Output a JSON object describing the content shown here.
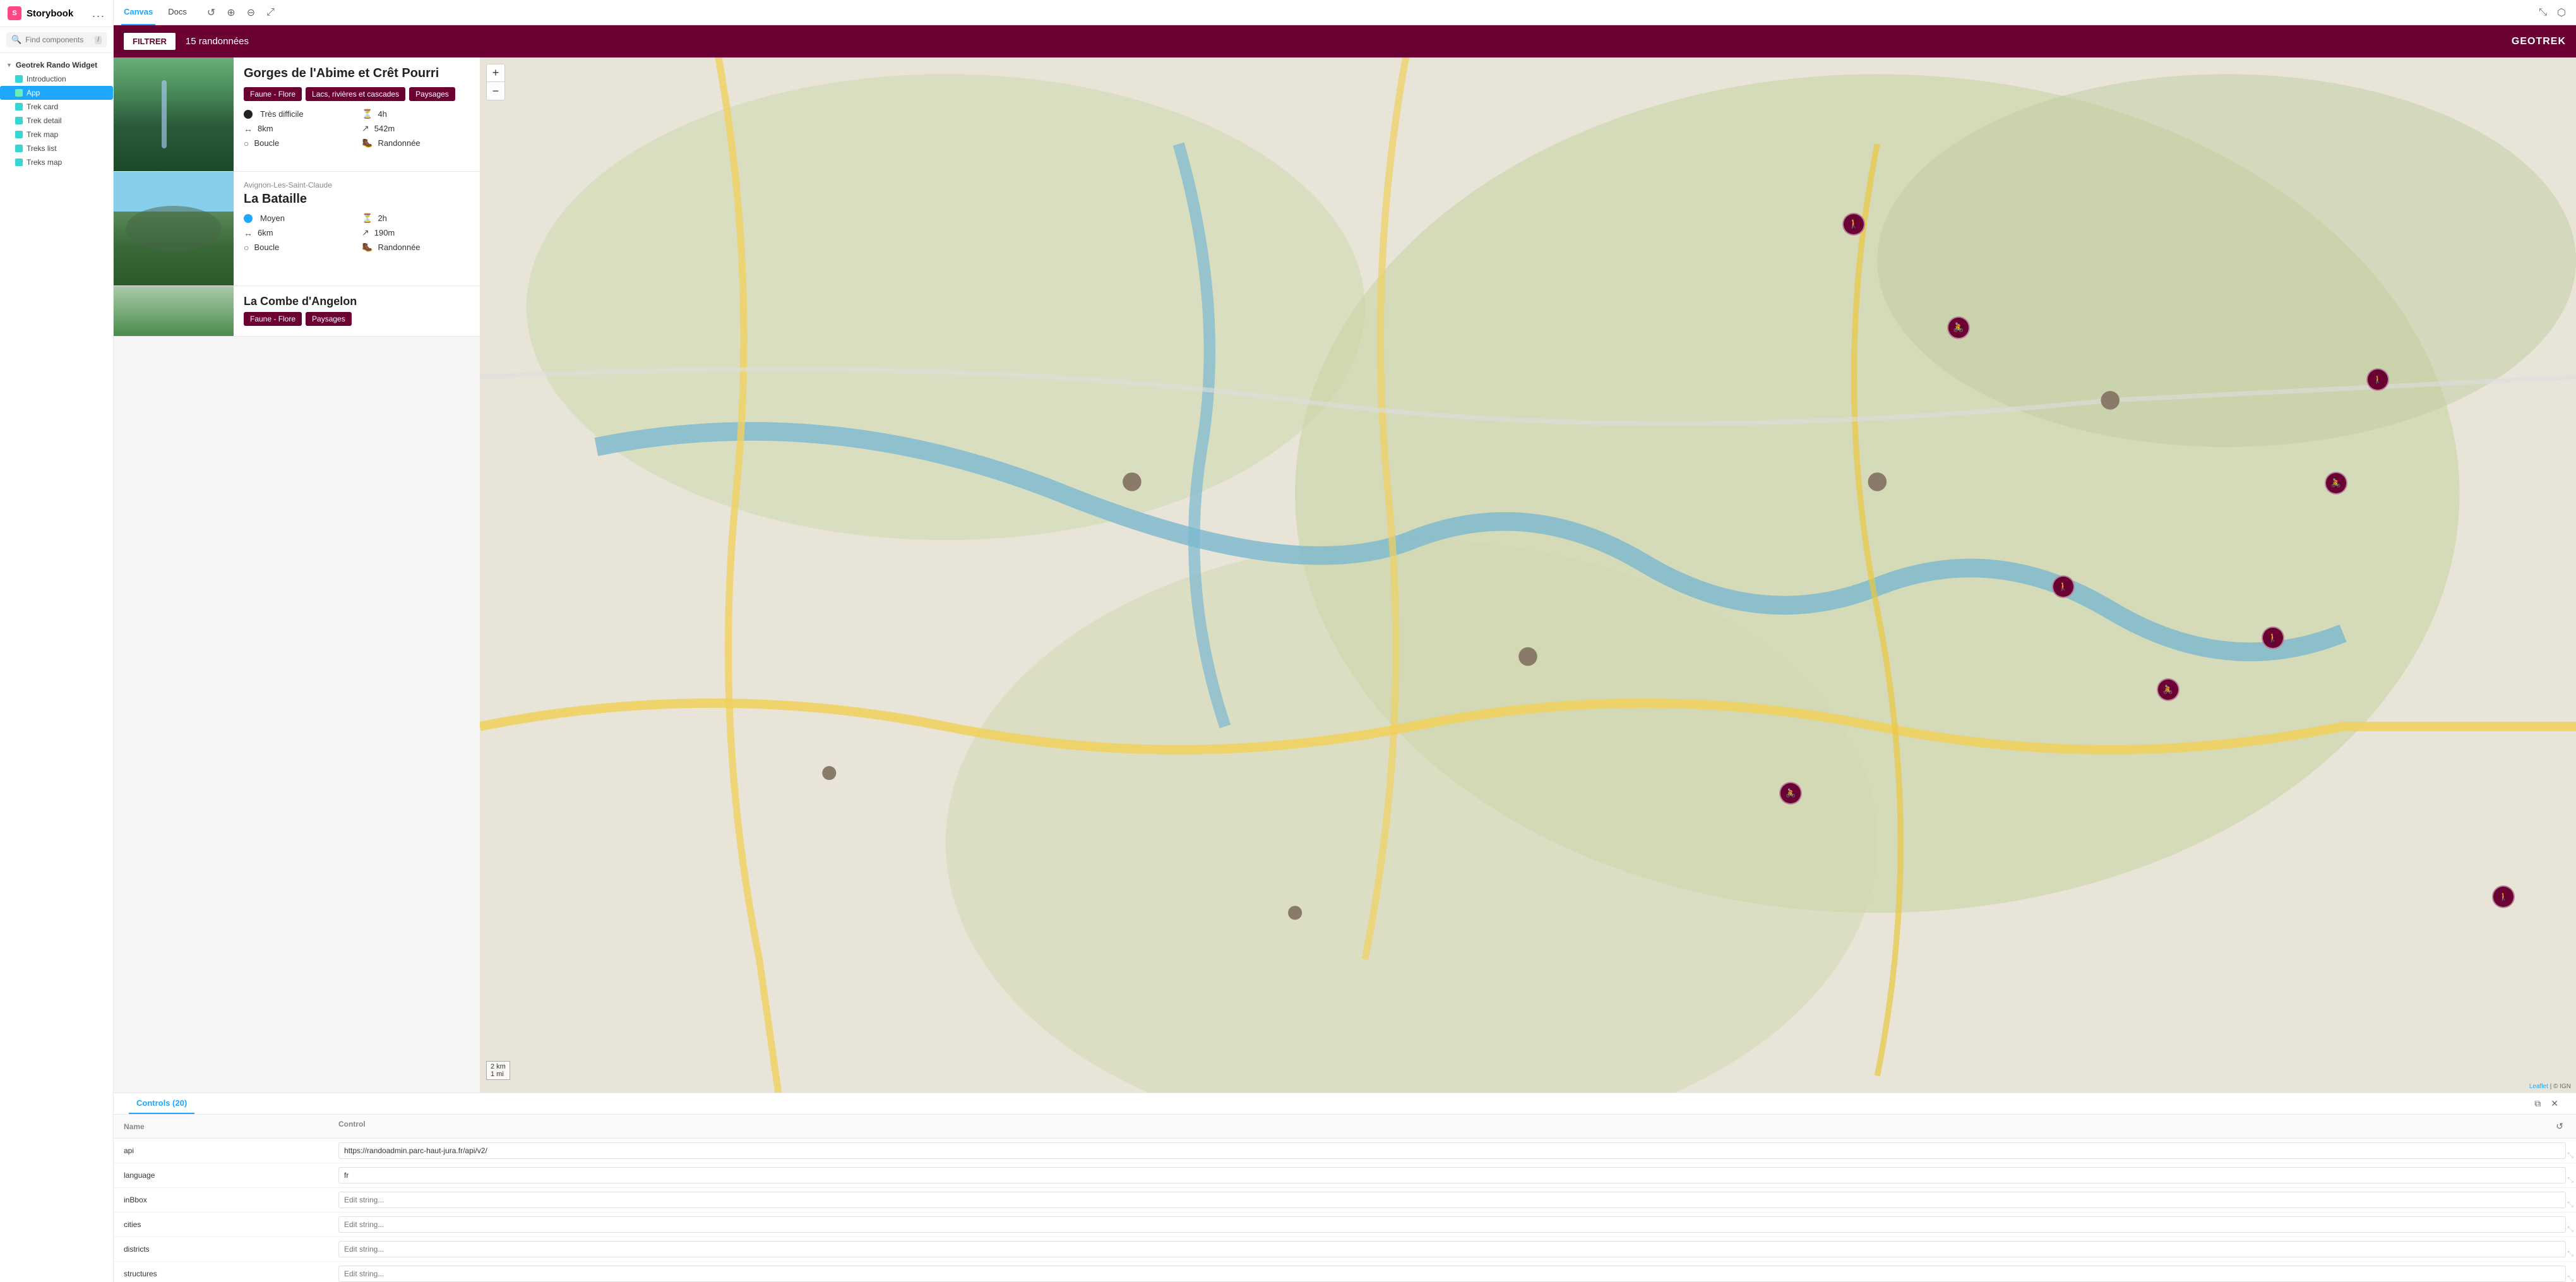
{
  "sidebar": {
    "logo": "Storybook",
    "menu_dots": "...",
    "search_placeholder": "Find components",
    "slash_key": "/",
    "tree": {
      "group_label": "Geotrek Rando Widget",
      "items": [
        {
          "label": "Introduction",
          "icon": "story",
          "active": false
        },
        {
          "label": "App",
          "icon": "component",
          "active": true
        },
        {
          "label": "Trek card",
          "icon": "story",
          "active": false
        },
        {
          "label": "Trek detail",
          "icon": "story",
          "active": false
        },
        {
          "label": "Trek map",
          "icon": "story",
          "active": false
        },
        {
          "label": "Treks list",
          "icon": "story",
          "active": false
        },
        {
          "label": "Treks map",
          "icon": "story",
          "active": false
        }
      ]
    }
  },
  "topbar": {
    "tabs": [
      {
        "label": "Canvas",
        "active": true
      },
      {
        "label": "Docs",
        "active": false
      }
    ],
    "icons": [
      "reset",
      "zoom-in",
      "zoom-out",
      "fit"
    ]
  },
  "widget": {
    "filter_btn": "FILTRER",
    "count": "15 randonnées",
    "brand": "GEOTREK",
    "treks": [
      {
        "title": "Gorges de l'Abime et Crêt Pourri",
        "tags": [
          "Faune - Flore",
          "Lacs, rivières et cascades",
          "Paysages"
        ],
        "difficulty": "Très difficile",
        "difficulty_type": "hard",
        "duration": "4h",
        "distance": "8km",
        "elevation": "542m",
        "circuit": "Boucle",
        "activity": "Randonnée",
        "img_type": "forest"
      },
      {
        "subtitle": "Avignon-Les-Saint-Claude",
        "title": "La Bataille",
        "tags": [],
        "difficulty": "Moyen",
        "difficulty_type": "medium",
        "duration": "2h",
        "distance": "6km",
        "elevation": "190m",
        "circuit": "Boucle",
        "activity": "Randonnée",
        "img_type": "mountain"
      },
      {
        "title": "La Combe d'Angelon",
        "tags": [
          "Faune - Flore",
          "Paysages"
        ],
        "difficulty": "",
        "img_type": "forest-light"
      }
    ]
  },
  "controls": {
    "tab_label": "Controls (20)",
    "columns": [
      "Name",
      "Control"
    ],
    "rows": [
      {
        "name": "api",
        "value": "https://randoadmin.parc-haut-jura.fr/api/v2/",
        "placeholder": "",
        "has_value": true
      },
      {
        "name": "language",
        "value": "fr",
        "placeholder": "",
        "has_value": true
      },
      {
        "name": "inBbox",
        "value": "",
        "placeholder": "Edit string...",
        "has_value": false
      },
      {
        "name": "cities",
        "value": "",
        "placeholder": "Edit string...",
        "has_value": false
      },
      {
        "name": "districts",
        "value": "",
        "placeholder": "Edit string...",
        "has_value": false
      },
      {
        "name": "structures",
        "value": "",
        "placeholder": "Edit string...",
        "has_value": false
      }
    ],
    "reset_icon": "↺",
    "window_icon": "⧉",
    "close_icon": "✕"
  },
  "map": {
    "zoom_plus": "+",
    "zoom_minus": "−",
    "scale_2km": "2 km",
    "scale_1mi": "1 mi",
    "attribution": "Leaflet | © IGN"
  }
}
